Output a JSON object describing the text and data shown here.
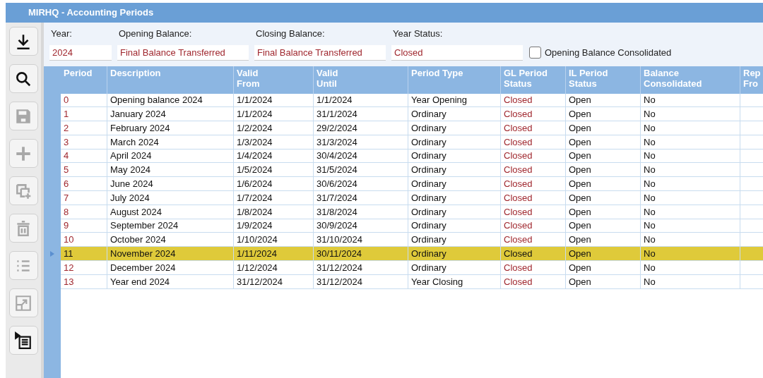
{
  "window": {
    "title": "MIRHQ - Accounting Periods"
  },
  "toolbar": [
    {
      "kind": "download",
      "disabled": false
    },
    {
      "kind": "search",
      "disabled": false
    },
    {
      "kind": "save",
      "disabled": true
    },
    {
      "kind": "add",
      "disabled": true
    },
    {
      "kind": "copy",
      "disabled": true
    },
    {
      "kind": "delete",
      "disabled": true
    },
    {
      "kind": "list",
      "disabled": true
    },
    {
      "kind": "expand",
      "disabled": true
    },
    {
      "kind": "details",
      "disabled": false
    }
  ],
  "form": {
    "fields": [
      {
        "label": "Year:",
        "value": "2024"
      },
      {
        "label": "Opening Balance:",
        "value": "Final Balance Transferred"
      },
      {
        "label": "Closing Balance:",
        "value": "Final Balance Transferred"
      },
      {
        "label": "Year Status:",
        "value": "Closed"
      }
    ],
    "checkbox": {
      "label": "Opening Balance Consolidated",
      "checked": false
    }
  },
  "table": {
    "columns": [
      "Period",
      "Description",
      "Valid From",
      "Valid Until",
      "Period Type",
      "GL Period Status",
      "IL Period Status",
      "Balance Consolidated",
      "Rep Fro"
    ],
    "rows": [
      {
        "selected": false,
        "cells": [
          "0",
          "Opening balance 2024",
          "1/1/2024",
          "1/1/2024",
          "Year Opening",
          "Closed",
          "Open",
          "No"
        ]
      },
      {
        "selected": false,
        "cells": [
          "1",
          "January 2024",
          "1/1/2024",
          "31/1/2024",
          "Ordinary",
          "Closed",
          "Open",
          "No"
        ]
      },
      {
        "selected": false,
        "cells": [
          "2",
          "February 2024",
          "1/2/2024",
          "29/2/2024",
          "Ordinary",
          "Closed",
          "Open",
          "No"
        ]
      },
      {
        "selected": false,
        "cells": [
          "3",
          "March 2024",
          "1/3/2024",
          "31/3/2024",
          "Ordinary",
          "Closed",
          "Open",
          "No"
        ]
      },
      {
        "selected": false,
        "cells": [
          "4",
          "April 2024",
          "1/4/2024",
          "30/4/2024",
          "Ordinary",
          "Closed",
          "Open",
          "No"
        ]
      },
      {
        "selected": false,
        "cells": [
          "5",
          "May 2024",
          "1/5/2024",
          "31/5/2024",
          "Ordinary",
          "Closed",
          "Open",
          "No"
        ]
      },
      {
        "selected": false,
        "cells": [
          "6",
          "June 2024",
          "1/6/2024",
          "30/6/2024",
          "Ordinary",
          "Closed",
          "Open",
          "No"
        ]
      },
      {
        "selected": false,
        "cells": [
          "7",
          "July 2024",
          "1/7/2024",
          "31/7/2024",
          "Ordinary",
          "Closed",
          "Open",
          "No"
        ]
      },
      {
        "selected": false,
        "cells": [
          "8",
          "August 2024",
          "1/8/2024",
          "31/8/2024",
          "Ordinary",
          "Closed",
          "Open",
          "No"
        ]
      },
      {
        "selected": false,
        "cells": [
          "9",
          "September 2024",
          "1/9/2024",
          "30/9/2024",
          "Ordinary",
          "Closed",
          "Open",
          "No"
        ]
      },
      {
        "selected": false,
        "cells": [
          "10",
          "October 2024",
          "1/10/2024",
          "31/10/2024",
          "Ordinary",
          "Closed",
          "Open",
          "No"
        ]
      },
      {
        "selected": true,
        "cells": [
          "11",
          "November 2024",
          "1/11/2024",
          "30/11/2024",
          "Ordinary",
          "Closed",
          "Open",
          "No"
        ]
      },
      {
        "selected": false,
        "cells": [
          "12",
          "December 2024",
          "1/12/2024",
          "31/12/2024",
          "Ordinary",
          "Closed",
          "Open",
          "No"
        ]
      },
      {
        "selected": false,
        "cells": [
          "13",
          "Year end 2024",
          "31/12/2024",
          "31/12/2024",
          "Year Closing",
          "Closed",
          "Open",
          "No"
        ]
      }
    ]
  }
}
